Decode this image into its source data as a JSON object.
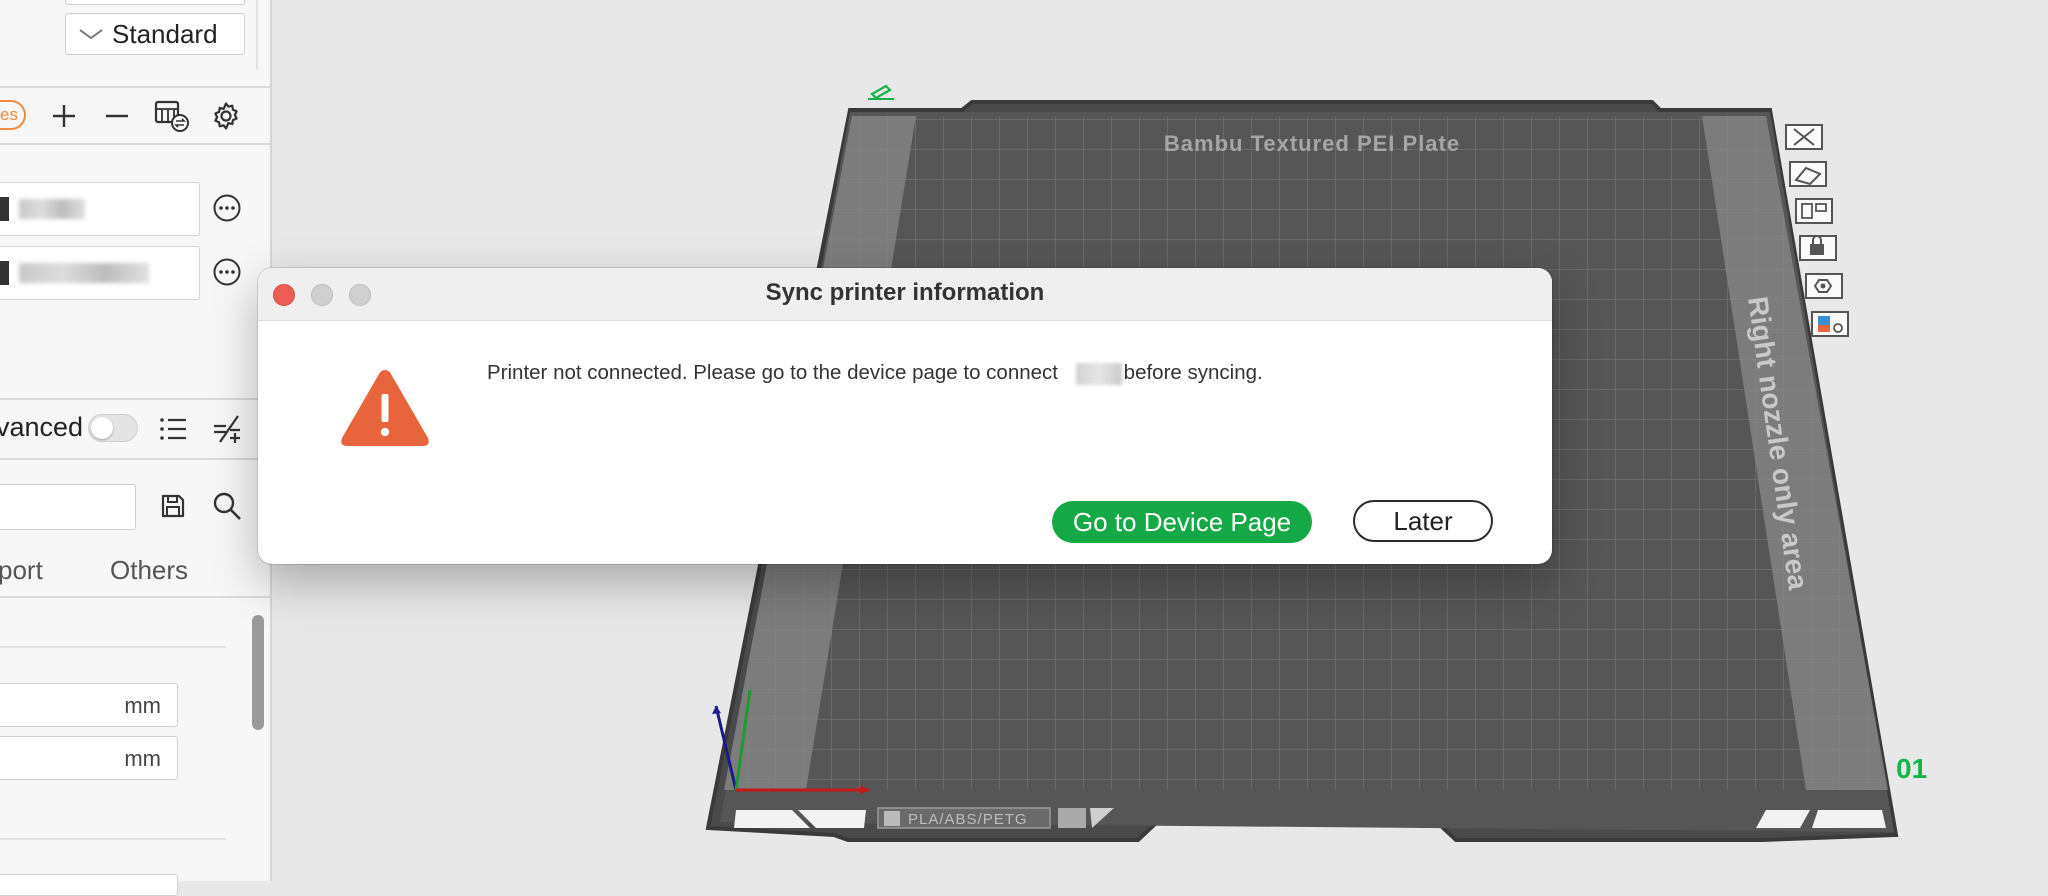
{
  "sidebar": {
    "print_preset_value": "Standard",
    "orange_badge": "es",
    "filament_rows": [
      {
        "name": ""
      },
      {
        "name": ""
      }
    ],
    "advanced_label": "vanced",
    "tabs": [
      {
        "label": "port"
      },
      {
        "label": "Others"
      }
    ],
    "fields": [
      {
        "unit": "mm"
      },
      {
        "unit": "mm"
      }
    ]
  },
  "plate": {
    "brand_label": "Bambu Textured PEI Plate",
    "side_label": "Right nozzle only area",
    "compat_label": "PLA/ABS/PETG",
    "plate_number": "01"
  },
  "dialog": {
    "title": "Sync printer information",
    "message_before": "Printer not connected. Please go to the device page to connect ",
    "message_after": "before syncing.",
    "primary_button": "Go to Device Page",
    "secondary_button": "Later"
  },
  "colors": {
    "accent_green": "#15a846",
    "warning_orange": "#e8643c",
    "close_red": "#ec5e55",
    "badge_orange": "#f08a3e"
  }
}
